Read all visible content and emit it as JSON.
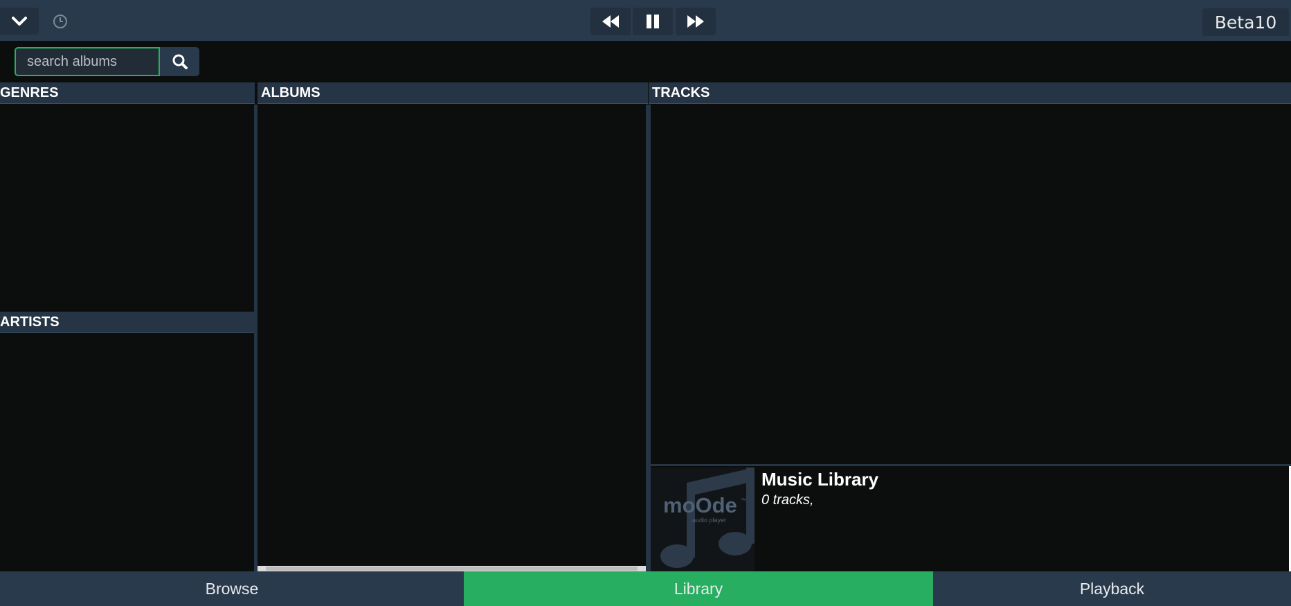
{
  "topbar": {
    "menu_icon": "chevron-down-icon",
    "clock_icon": "clock-icon",
    "prev_icon": "fast-backward-icon",
    "pause_icon": "pause-icon",
    "next_icon": "fast-forward-icon",
    "version": "Beta10"
  },
  "search": {
    "placeholder": "search albums",
    "value": "",
    "button_icon": "search-icon"
  },
  "columns": {
    "genres": "GENRES",
    "artists": "ARTISTS",
    "albums": "ALBUMS",
    "tracks": "TRACKS"
  },
  "library": {
    "title": "Music Library",
    "count": "0 tracks,",
    "cover_text": "moOde",
    "cover_subtext": "audio player",
    "cover_tm": "™"
  },
  "tabs": [
    {
      "label": "Browse",
      "active": false
    },
    {
      "label": "Library",
      "active": true
    },
    {
      "label": "Playback",
      "active": false
    }
  ],
  "colors": {
    "accent": "#27ae60",
    "bar": "#2a3a4d",
    "background": "#0c0e0e"
  }
}
